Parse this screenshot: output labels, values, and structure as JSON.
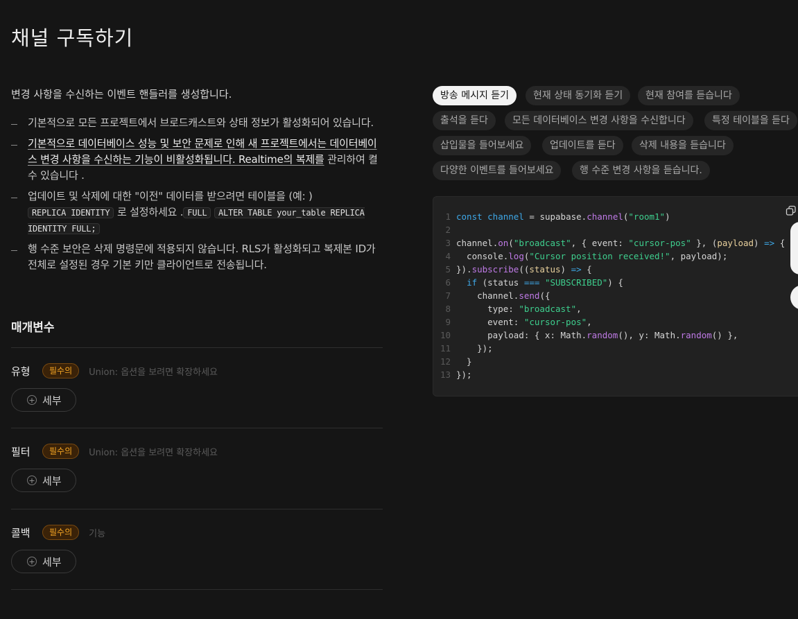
{
  "page": {
    "title": "채널 구독하기"
  },
  "intro": "변경 사항을 수신하는 이벤트 핸들러를 생성합니다.",
  "notes": {
    "n1": "기본적으로 모든 프로젝트에서 브로드캐스트와 상태 정보가 활성화되어 있습니다.",
    "n2_strong": "기본적으로 데이터베이스 성능 및 보안 문제로 인해 새 프로젝트에서는 데이터베이스 변경 사항을 수신하는 기능이 비활성화됩니다. Realtime의 복제를",
    "n2_rest": " 관리하여 켤 수 있습니다 .",
    "n3_a": "업데이트 및 삭제에 대한 \"이전\" 데이터를 받으려면 테이블을 (예: )",
    "n3_code1": "REPLICA IDENTITY",
    "n3_b": " 로 설정하세요 .",
    "n3_code2": "FULL",
    "n3_code3": "ALTER TABLE your_table REPLICA IDENTITY FULL;",
    "n4": "행 수준 보안은 삭제 명령문에 적용되지 않습니다. RLS가 활성화되고 복제본 ID가 전체로 설정된 경우 기본 키만 클라이언트로 전송됩니다."
  },
  "params": {
    "title": "매개변수",
    "items": [
      {
        "name": "유형",
        "badge": "필수의",
        "type": "Union: 옵션을 보려면 확장하세요",
        "button": "세부"
      },
      {
        "name": "필터",
        "badge": "필수의",
        "type": "Union: 옵션을 보려면 확장하세요",
        "button": "세부"
      },
      {
        "name": "콜백",
        "badge": "필수의",
        "type": "기능",
        "button": "세부"
      }
    ]
  },
  "examples": {
    "chips": [
      {
        "label": "방송 메시지 듣기",
        "active": true
      },
      {
        "label": "현재 상태 동기화 듣기",
        "active": false
      },
      {
        "label": "현재 참여를 듣습니다",
        "active": false
      },
      {
        "label": "출석을 듣다",
        "active": false
      },
      {
        "label": "모든 데이터베이스 변경 사항을 수신합니다",
        "active": false
      },
      {
        "label": "특정 테이블을 듣다",
        "active": false
      },
      {
        "label": "삽입물을 들어보세요",
        "active": false
      },
      {
        "label": "업데이트를 듣다",
        "active": false
      },
      {
        "label": "삭제 내용을 듣습니다",
        "active": false
      },
      {
        "label": "다양한 이벤트를 들어보세요",
        "active": false
      },
      {
        "label": "행 수준 변경 사항을 듣습니다.",
        "active": false
      }
    ]
  },
  "code": {
    "lines": [
      [
        [
          "k",
          "const "
        ],
        [
          "k",
          "channel "
        ],
        [
          "p",
          "= "
        ],
        [
          "p",
          "supabase"
        ],
        [
          "p",
          "."
        ],
        [
          "f",
          "channel"
        ],
        [
          "p",
          "("
        ],
        [
          "s",
          "\"room1\""
        ],
        [
          "p",
          ")"
        ]
      ],
      [],
      [
        [
          "p",
          "channel"
        ],
        [
          "p",
          "."
        ],
        [
          "f",
          "on"
        ],
        [
          "p",
          "("
        ],
        [
          "s",
          "\"broadcast\""
        ],
        [
          "p",
          ", { event: "
        ],
        [
          "s",
          "\"cursor-pos\""
        ],
        [
          "p",
          " }, ("
        ],
        [
          "v",
          "payload"
        ],
        [
          "p",
          ") "
        ],
        [
          "k",
          "=>"
        ],
        [
          "p",
          " {"
        ]
      ],
      [
        [
          "p",
          "  console"
        ],
        [
          "p",
          "."
        ],
        [
          "f",
          "log"
        ],
        [
          "p",
          "("
        ],
        [
          "s",
          "\"Cursor position received!\""
        ],
        [
          "p",
          ", payload);"
        ]
      ],
      [
        [
          "p",
          "})."
        ],
        [
          "f",
          "subscribe"
        ],
        [
          "p",
          "(("
        ],
        [
          "v",
          "status"
        ],
        [
          "p",
          ") "
        ],
        [
          "k",
          "=>"
        ],
        [
          "p",
          " {"
        ]
      ],
      [
        [
          "p",
          "  "
        ],
        [
          "k",
          "if"
        ],
        [
          "p",
          " (status "
        ],
        [
          "k",
          "==="
        ],
        [
          "p",
          " "
        ],
        [
          "s",
          "\"SUBSCRIBED\""
        ],
        [
          "p",
          ") {"
        ]
      ],
      [
        [
          "p",
          "    channel"
        ],
        [
          "p",
          "."
        ],
        [
          "f",
          "send"
        ],
        [
          "p",
          "({"
        ]
      ],
      [
        [
          "p",
          "      type: "
        ],
        [
          "s",
          "\"broadcast\""
        ],
        [
          "p",
          ","
        ]
      ],
      [
        [
          "p",
          "      event: "
        ],
        [
          "s",
          "\"cursor-pos\""
        ],
        [
          "p",
          ","
        ]
      ],
      [
        [
          "p",
          "      payload: { x: Math."
        ],
        [
          "f",
          "random"
        ],
        [
          "p",
          "(), y: Math."
        ],
        [
          "f",
          "random"
        ],
        [
          "p",
          "() },"
        ]
      ],
      [
        [
          "p",
          "    });"
        ]
      ],
      [
        [
          "p",
          "  }"
        ]
      ],
      [
        [
          "p",
          "});"
        ]
      ]
    ]
  },
  "icons": {
    "copy": "copy-icon",
    "plus": "plus-circle-icon"
  },
  "colors": {
    "background": "#151515",
    "badge": "#f5a623",
    "string": "#3ecf8e",
    "keyword": "#3ea8e8"
  }
}
